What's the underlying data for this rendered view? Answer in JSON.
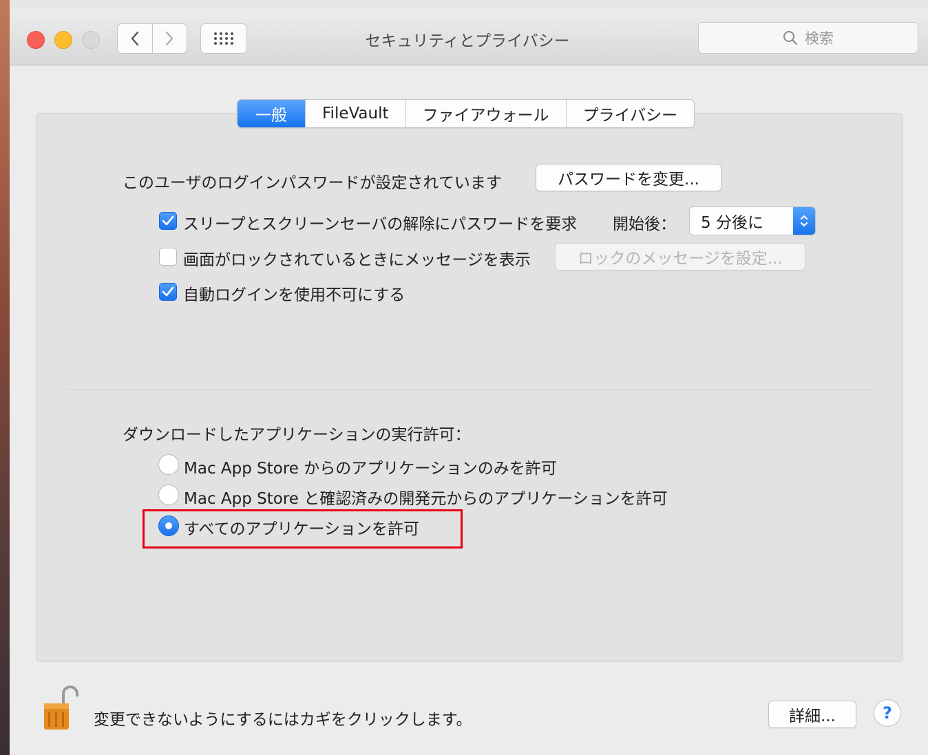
{
  "window": {
    "title": "セキュリティとプライバシー",
    "search_placeholder": "検索"
  },
  "tabs": [
    {
      "label": "一般",
      "active": true
    },
    {
      "label": "FileVault",
      "active": false
    },
    {
      "label": "ファイアウォール",
      "active": false
    },
    {
      "label": "プライバシー",
      "active": false
    }
  ],
  "general": {
    "password_status": "このユーザのログインパスワードが設定されています",
    "change_password_button": "パスワードを変更...",
    "require_password": {
      "label": "スリープとスクリーンセーバの解除にパスワードを要求",
      "checked": true,
      "after_label": "開始後：",
      "delay_value": "5 分後に"
    },
    "show_message": {
      "label": "画面がロックされているときにメッセージを表示",
      "checked": false,
      "button": "ロックのメッセージを設定..."
    },
    "disable_auto_login": {
      "label": "自動ログインを使用不可にする",
      "checked": true
    }
  },
  "downloads": {
    "heading": "ダウンロードしたアプリケーションの実行許可：",
    "options": [
      {
        "label": "Mac App Store からのアプリケーションのみを許可",
        "selected": false
      },
      {
        "label": "Mac App Store と確認済みの開発元からのアプリケーションを許可",
        "selected": false
      },
      {
        "label": "すべてのアプリケーションを許可",
        "selected": true
      }
    ]
  },
  "footer": {
    "lock_message": "変更できないようにするにはカギをクリックします。",
    "advanced_button": "詳細...",
    "help_label": "?"
  },
  "colors": {
    "accent": "#1a72ec",
    "highlight_box": "#e60012"
  }
}
